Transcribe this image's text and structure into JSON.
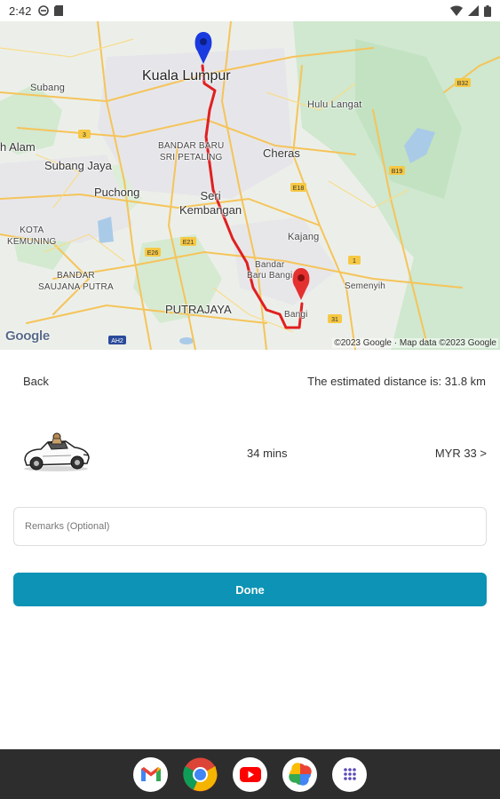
{
  "status_bar": {
    "time": "2:42",
    "icons_left": [
      "do-not-disturb-icon",
      "sd-card-icon"
    ],
    "icons_right": [
      "wifi-icon",
      "signal-icon",
      "battery-icon"
    ]
  },
  "map": {
    "labels": {
      "kuala_lumpur": "Kuala Lumpur",
      "subang": "Subang",
      "hulu_langat": "Hulu Langat",
      "alam": "h Alam",
      "bandar_baru_sri_petaling": "BANDAR BARU\nSRI PETALING",
      "cheras": "Cheras",
      "subang_jaya": "Subang Jaya",
      "puchong": "Puchong",
      "seri_kembangan": "Seri\nKembangan",
      "kota_kemuning": "KOTA\nKEMUNING",
      "kajang": "Kajang",
      "bandar_saujana_putra": "BANDAR\nSAUJANA PUTRA",
      "bandar_baru_bangi": "Bandar\nBaru Bangi",
      "semenyih": "Semenyih",
      "putrajaya": "PUTRAJAYA",
      "bangi": "Bangi",
      "road_b32": "B32",
      "road_e18": "E18",
      "road_e21": "E21",
      "road_e26": "E26",
      "road_ah2": "AH2",
      "road_1": "1",
      "road_3": "3",
      "road_31": "31",
      "road_b19": "B19"
    },
    "google_logo": "Google",
    "attribution": "©2023 Google · Map data ©2023 Google"
  },
  "route": {
    "back_label": "Back",
    "distance_text": "The estimated distance is: 31.8 km",
    "duration": "34 mins",
    "price": "MYR 33 >"
  },
  "remarks": {
    "placeholder": "Remarks (Optional)",
    "value": ""
  },
  "done_label": "Done",
  "dock": {
    "apps": [
      "Gmail",
      "Chrome",
      "YouTube",
      "Photos",
      "App drawer"
    ]
  },
  "colors": {
    "done_button": "#0c93b5",
    "route_line": "#e02020",
    "origin_pin": "#1a3be0",
    "destination_pin": "#e53030",
    "dock_bg": "#2d2d2d"
  }
}
